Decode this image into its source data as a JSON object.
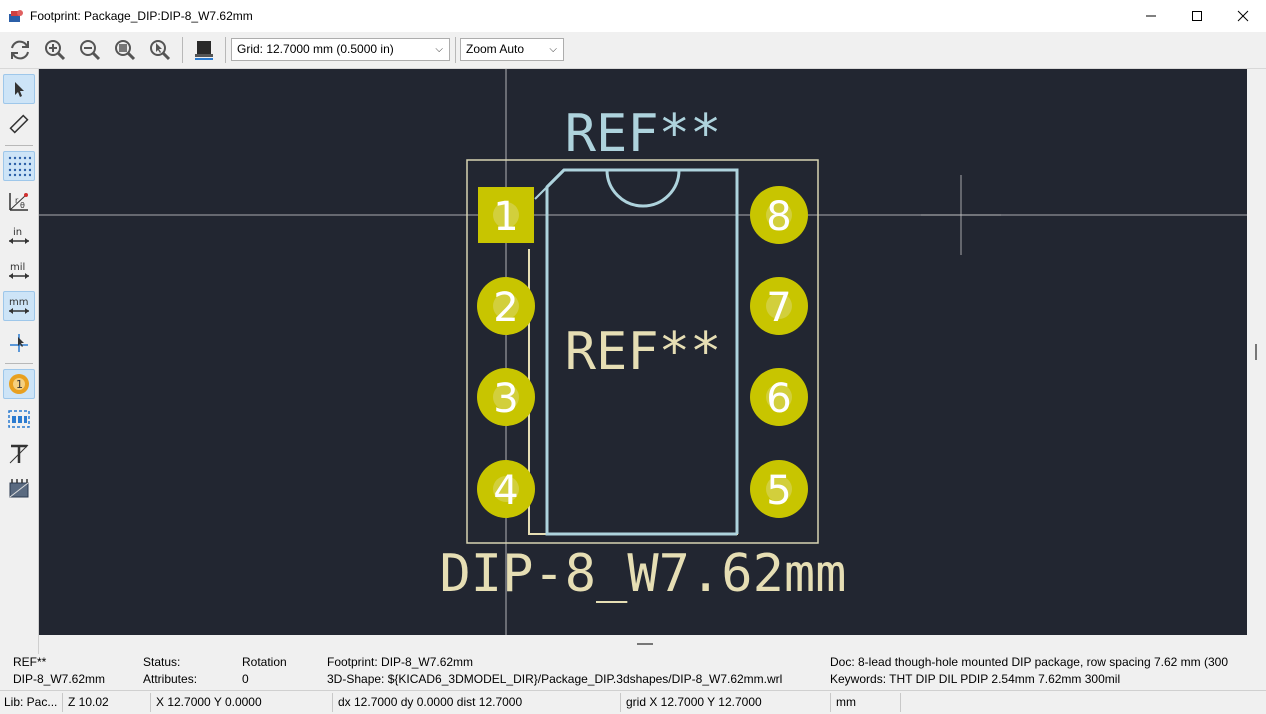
{
  "window": {
    "title": "Footprint: Package_DIP:DIP-8_W7.62mm",
    "minimize": "—",
    "maximize": "☐",
    "close": "✕"
  },
  "toolbar": {
    "grid_select": "Grid: 12.7000 mm (0.5000 in)",
    "zoom_select": "Zoom Auto",
    "buttons": [
      "refresh-icon",
      "zoom-in-icon",
      "zoom-out-icon",
      "zoom-fit-icon",
      "zoom-to-objects-icon",
      "3d-viewer-icon"
    ]
  },
  "left_toolbar": {
    "tools": [
      "select-icon",
      "measure-icon",
      "grid-icon",
      "polar-coords-icon",
      "inch-units-icon",
      "mil-units-icon",
      "mm-units-icon",
      "cursor-cross-icon",
      "pad-number-icon",
      "graphic-fill-icon",
      "text-outline-icon",
      "3d-box-icon"
    ]
  },
  "footprint": {
    "ref_top": "REF**",
    "ref_fab": "REF**",
    "value": "DIP-8_W7.62mm",
    "pads": [
      "1",
      "2",
      "3",
      "4",
      "5",
      "6",
      "7",
      "8"
    ],
    "colors": {
      "background": "#222631",
      "silk": "#e6deb4",
      "courtyard": "#d8d4b2",
      "fab": "#aed3dd",
      "pad": "#c8c500",
      "pad_text": "#ffffff"
    }
  },
  "message_panel": {
    "ref": "REF**",
    "name": "DIP-8_W7.62mm",
    "status_label": "Status:",
    "attributes_label": "Attributes:",
    "rotation_label": "Rotation",
    "rotation_value": "0",
    "footprint": "Footprint: DIP-8_W7.62mm",
    "shape3d": "3D-Shape: ${KICAD6_3DMODEL_DIR}/Package_DIP.3dshapes/DIP-8_W7.62mm.wrl",
    "doc": "Doc: 8-lead though-hole mounted DIP package, row spacing 7.62 mm (300",
    "keywords": "Keywords: THT DIP DIL PDIP 2.54mm 7.62mm 300mil"
  },
  "statusbar": {
    "lib": "Lib: Pac...",
    "zoom": "Z 10.02",
    "xy": "X 12.7000  Y 0.0000",
    "delta": "dx 12.7000  dy 0.0000  dist 12.7000",
    "grid": "grid X 12.7000  Y 12.7000",
    "units": "mm"
  }
}
